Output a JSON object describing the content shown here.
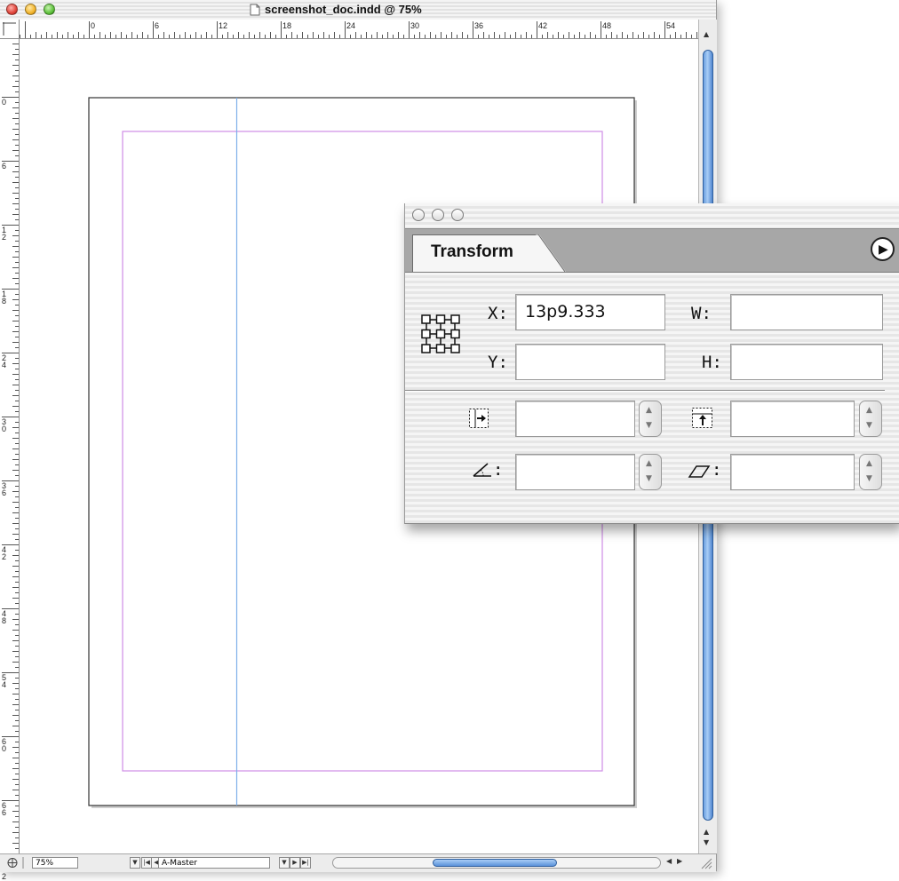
{
  "window": {
    "title": "screenshot_doc.indd @ 75%"
  },
  "rulers": {
    "horizontal_labels": [
      "0",
      "6",
      "12",
      "18",
      "24",
      "30",
      "36",
      "42",
      "48",
      "54"
    ],
    "vertical_labels": [
      "0",
      "6",
      "12",
      "18",
      "24",
      "30",
      "36",
      "42",
      "48",
      "54",
      "60",
      "66",
      "72"
    ]
  },
  "status_bar": {
    "zoom": "75%",
    "page": "A-Master"
  },
  "palette": {
    "tab_label": "Transform",
    "x_label": "X:",
    "x_value": "13p9.333",
    "y_label": "Y:",
    "y_value": "",
    "w_label": "W:",
    "w_value": "",
    "h_label": "H:",
    "h_value": "",
    "scale_x_value": "",
    "scale_y_value": "",
    "rotation_label": ":",
    "rotation_value": "",
    "shear_label": ":",
    "shear_value": ""
  },
  "colors": {
    "margin_guide": "#cf8de6",
    "ruler_guide": "#7eb0ea",
    "scrollbar_accent": "#6a9fe0"
  }
}
